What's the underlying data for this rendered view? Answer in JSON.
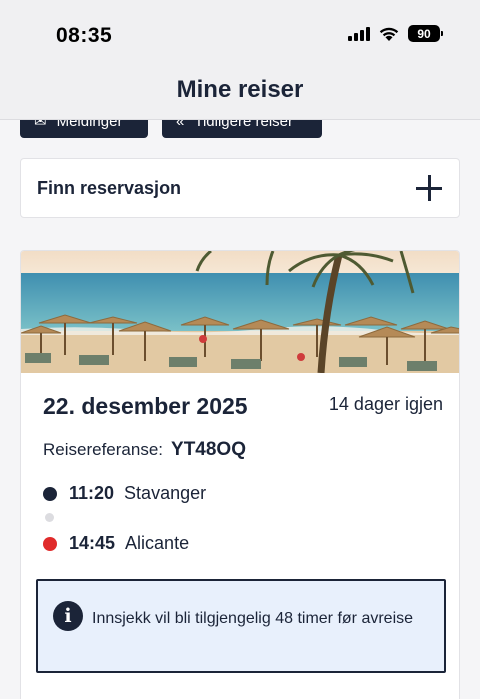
{
  "status_bar": {
    "time": "08:35",
    "battery": "90",
    "icons": [
      "signal-icon",
      "wifi-icon",
      "battery-icon"
    ]
  },
  "header": {
    "title": "Mine reiser"
  },
  "tabs": [
    {
      "label": "Meldinger",
      "icon": "envelope-icon"
    },
    {
      "label": "Tidligere reiser",
      "icon": "double-chevron-left-icon"
    }
  ],
  "find_reservation": {
    "label": "Finn reservasjon",
    "icon": "plus-icon"
  },
  "trip": {
    "image": "beach-palms-umbrellas",
    "date": "22. desember 2025",
    "countdown": "14 dager igjen",
    "reference_label": "Reisereferanse:",
    "reference_code": "YT48OQ",
    "departure": {
      "time": "11:20",
      "city": "Stavanger"
    },
    "arrival": {
      "time": "14:45",
      "city": "Alicante"
    },
    "info": {
      "icon": "info-icon",
      "text": "Innsjekk vil bli tilgjengelig 48 timer før avreise"
    }
  },
  "colors": {
    "navy": "#1b2438",
    "arrival_dot": "#e02b2b",
    "info_bg": "#e8f0fc"
  }
}
